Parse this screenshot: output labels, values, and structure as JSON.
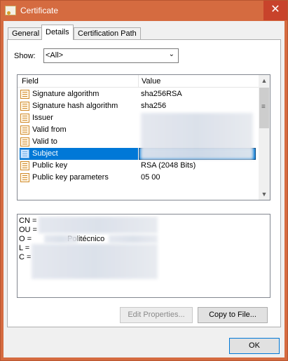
{
  "window": {
    "title": "Certificate",
    "close_glyph": "✕"
  },
  "tabs": [
    "General",
    "Details",
    "Certification Path"
  ],
  "active_tab": "Details",
  "show": {
    "label": "Show:",
    "value": "<All>"
  },
  "list": {
    "columns": {
      "field": "Field",
      "value": "Value"
    },
    "rows": [
      {
        "field": "Signature algorithm",
        "value": "sha256RSA"
      },
      {
        "field": "Signature hash algorithm",
        "value": "sha256"
      },
      {
        "field": "Issuer",
        "value": ""
      },
      {
        "field": "Valid from",
        "value": ""
      },
      {
        "field": "Valid to",
        "value": ""
      },
      {
        "field": "Subject",
        "value": ""
      },
      {
        "field": "Public key",
        "value": "RSA (2048 Bits)"
      },
      {
        "field": "Public key parameters",
        "value": "05 00"
      }
    ],
    "selected": "Subject"
  },
  "detail": {
    "lines": [
      {
        "key": "CN = ",
        "value": ""
      },
      {
        "key": "OU = ",
        "value": ""
      },
      {
        "key": "O = ",
        "value": "Politécnico"
      },
      {
        "key": "L = ",
        "value": ""
      },
      {
        "key": "C = ",
        "value": ""
      }
    ]
  },
  "buttons": {
    "edit_properties": "Edit Properties...",
    "copy_to_file": "Copy to File...",
    "ok": "OK"
  },
  "colors": {
    "titlebar": "#d56b40",
    "close": "#c8432b",
    "selection": "#0078d7"
  },
  "icons": {
    "title": "certificate-icon",
    "field": "field-property-icon"
  }
}
